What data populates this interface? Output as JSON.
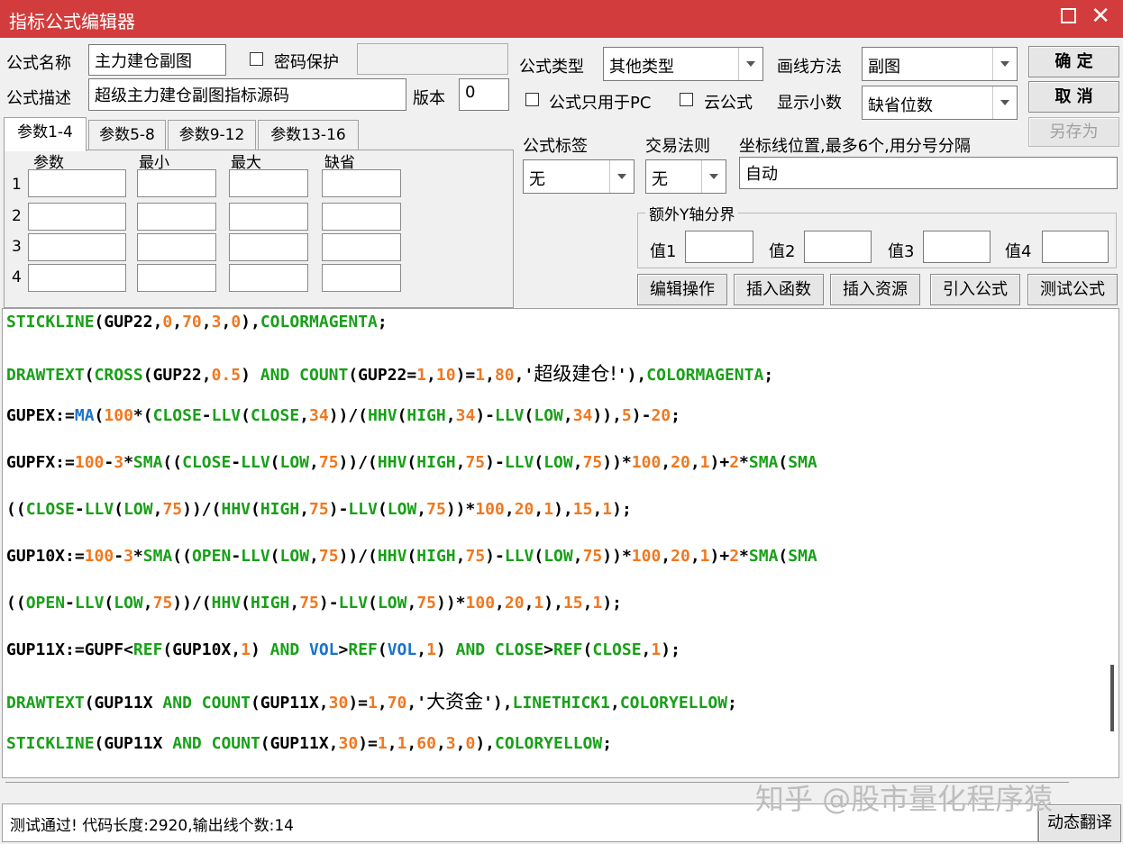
{
  "window": {
    "title": "指标公式编辑器"
  },
  "form": {
    "name_label": "公式名称",
    "name_value": "主力建仓副图",
    "password_label": "密码保护",
    "desc_label": "公式描述",
    "desc_value": "超级主力建仓副图指标源码",
    "version_label": "版本",
    "version_value": "0",
    "type_label": "公式类型",
    "type_value": "其他类型",
    "draw_label": "画线方法",
    "draw_value": "副图",
    "pc_only_label": "公式只用于PC",
    "cloud_label": "云公式",
    "decimals_label": "显示小数",
    "decimals_value": "缺省位数",
    "tag_label": "公式标签",
    "tag_value": "无",
    "trade_label": "交易法则",
    "trade_value": "无",
    "coord_label": "坐标线位置,最多6个,用分号分隔",
    "coord_value": "自动",
    "yaxis_legend": "额外Y轴分界",
    "y_values": [
      "值1",
      "值2",
      "值3",
      "值4"
    ]
  },
  "buttons": {
    "ok": "确 定",
    "cancel": "取 消",
    "save_as": "另存为",
    "edit_ops": "编辑操作",
    "insert_func": "插入函数",
    "insert_res": "插入资源",
    "import_formula": "引入公式",
    "test_formula": "测试公式",
    "dynamic_translate": "动态翻译"
  },
  "tabs": [
    "参数1-4",
    "参数5-8",
    "参数9-12",
    "参数13-16"
  ],
  "param_headers": [
    "参数",
    "最小",
    "最大",
    "缺省"
  ],
  "param_rows": [
    "1",
    "2",
    "3",
    "4"
  ],
  "code_lines": [
    [
      [
        "g",
        "STICKLINE"
      ],
      [
        "k",
        "(GUP22,"
      ],
      [
        "o",
        "0"
      ],
      [
        "k",
        ","
      ],
      [
        "o",
        "70"
      ],
      [
        "k",
        ","
      ],
      [
        "o",
        "3"
      ],
      [
        "k",
        ","
      ],
      [
        "o",
        "0"
      ],
      [
        "k",
        "),"
      ],
      [
        "g",
        "COLORMAGENTA"
      ],
      [
        "k",
        ";"
      ]
    ],
    [
      [
        "g",
        "DRAWTEXT"
      ],
      [
        "k",
        "("
      ],
      [
        "g",
        "CROSS"
      ],
      [
        "k",
        "(GUP22,"
      ],
      [
        "o",
        "0.5"
      ],
      [
        "k",
        ") "
      ],
      [
        "g",
        "AND"
      ],
      [
        "k",
        " "
      ],
      [
        "g",
        "COUNT"
      ],
      [
        "k",
        "(GUP22="
      ],
      [
        "o",
        "1"
      ],
      [
        "k",
        ","
      ],
      [
        "o",
        "10"
      ],
      [
        "k",
        ")="
      ],
      [
        "o",
        "1"
      ],
      [
        "k",
        ","
      ],
      [
        "o",
        "80"
      ],
      [
        "k",
        ",'"
      ],
      [
        "kz",
        "超级建仓!"
      ],
      [
        "k",
        "'),"
      ],
      [
        "g",
        "COLORMAGENTA"
      ],
      [
        "k",
        ";"
      ]
    ],
    [
      [
        "k",
        "GUPEX:="
      ],
      [
        "b",
        "MA"
      ],
      [
        "k",
        "("
      ],
      [
        "o",
        "100"
      ],
      [
        "k",
        "*("
      ],
      [
        "g",
        "CLOSE"
      ],
      [
        "k",
        "-"
      ],
      [
        "g",
        "LLV"
      ],
      [
        "k",
        "("
      ],
      [
        "g",
        "CLOSE"
      ],
      [
        "k",
        ","
      ],
      [
        "o",
        "34"
      ],
      [
        "k",
        "))/("
      ],
      [
        "g",
        "HHV"
      ],
      [
        "k",
        "("
      ],
      [
        "g",
        "HIGH"
      ],
      [
        "k",
        ","
      ],
      [
        "o",
        "34"
      ],
      [
        "k",
        ")-"
      ],
      [
        "g",
        "LLV"
      ],
      [
        "k",
        "("
      ],
      [
        "g",
        "LOW"
      ],
      [
        "k",
        ","
      ],
      [
        "o",
        "34"
      ],
      [
        "k",
        ")),"
      ],
      [
        "o",
        "5"
      ],
      [
        "k",
        ")-"
      ],
      [
        "o",
        "20"
      ],
      [
        "k",
        ";"
      ]
    ],
    [
      [
        "k",
        "GUPFX:="
      ],
      [
        "o",
        "100"
      ],
      [
        "k",
        "-"
      ],
      [
        "o",
        "3"
      ],
      [
        "k",
        "*"
      ],
      [
        "g",
        "SMA"
      ],
      [
        "k",
        "(("
      ],
      [
        "g",
        "CLOSE"
      ],
      [
        "k",
        "-"
      ],
      [
        "g",
        "LLV"
      ],
      [
        "k",
        "("
      ],
      [
        "g",
        "LOW"
      ],
      [
        "k",
        ","
      ],
      [
        "o",
        "75"
      ],
      [
        "k",
        "))/("
      ],
      [
        "g",
        "HHV"
      ],
      [
        "k",
        "("
      ],
      [
        "g",
        "HIGH"
      ],
      [
        "k",
        ","
      ],
      [
        "o",
        "75"
      ],
      [
        "k",
        ")-"
      ],
      [
        "g",
        "LLV"
      ],
      [
        "k",
        "("
      ],
      [
        "g",
        "LOW"
      ],
      [
        "k",
        ","
      ],
      [
        "o",
        "75"
      ],
      [
        "k",
        "))*"
      ],
      [
        "o",
        "100"
      ],
      [
        "k",
        ","
      ],
      [
        "o",
        "20"
      ],
      [
        "k",
        ","
      ],
      [
        "o",
        "1"
      ],
      [
        "k",
        ")+"
      ],
      [
        "o",
        "2"
      ],
      [
        "k",
        "*"
      ],
      [
        "g",
        "SMA"
      ],
      [
        "k",
        "("
      ],
      [
        "g",
        "SMA"
      ]
    ],
    [
      [
        "k",
        "(("
      ],
      [
        "g",
        "CLOSE"
      ],
      [
        "k",
        "-"
      ],
      [
        "g",
        "LLV"
      ],
      [
        "k",
        "("
      ],
      [
        "g",
        "LOW"
      ],
      [
        "k",
        ","
      ],
      [
        "o",
        "75"
      ],
      [
        "k",
        "))/("
      ],
      [
        "g",
        "HHV"
      ],
      [
        "k",
        "("
      ],
      [
        "g",
        "HIGH"
      ],
      [
        "k",
        ","
      ],
      [
        "o",
        "75"
      ],
      [
        "k",
        ")-"
      ],
      [
        "g",
        "LLV"
      ],
      [
        "k",
        "("
      ],
      [
        "g",
        "LOW"
      ],
      [
        "k",
        ","
      ],
      [
        "o",
        "75"
      ],
      [
        "k",
        "))*"
      ],
      [
        "o",
        "100"
      ],
      [
        "k",
        ","
      ],
      [
        "o",
        "20"
      ],
      [
        "k",
        ","
      ],
      [
        "o",
        "1"
      ],
      [
        "k",
        "),"
      ],
      [
        "o",
        "15"
      ],
      [
        "k",
        ","
      ],
      [
        "o",
        "1"
      ],
      [
        "k",
        ");"
      ]
    ],
    [
      [
        "k",
        "GUP10X:="
      ],
      [
        "o",
        "100"
      ],
      [
        "k",
        "-"
      ],
      [
        "o",
        "3"
      ],
      [
        "k",
        "*"
      ],
      [
        "g",
        "SMA"
      ],
      [
        "k",
        "(("
      ],
      [
        "g",
        "OPEN"
      ],
      [
        "k",
        "-"
      ],
      [
        "g",
        "LLV"
      ],
      [
        "k",
        "("
      ],
      [
        "g",
        "LOW"
      ],
      [
        "k",
        ","
      ],
      [
        "o",
        "75"
      ],
      [
        "k",
        "))/("
      ],
      [
        "g",
        "HHV"
      ],
      [
        "k",
        "("
      ],
      [
        "g",
        "HIGH"
      ],
      [
        "k",
        ","
      ],
      [
        "o",
        "75"
      ],
      [
        "k",
        ")-"
      ],
      [
        "g",
        "LLV"
      ],
      [
        "k",
        "("
      ],
      [
        "g",
        "LOW"
      ],
      [
        "k",
        ","
      ],
      [
        "o",
        "75"
      ],
      [
        "k",
        "))*"
      ],
      [
        "o",
        "100"
      ],
      [
        "k",
        ","
      ],
      [
        "o",
        "20"
      ],
      [
        "k",
        ","
      ],
      [
        "o",
        "1"
      ],
      [
        "k",
        ")+"
      ],
      [
        "o",
        "2"
      ],
      [
        "k",
        "*"
      ],
      [
        "g",
        "SMA"
      ],
      [
        "k",
        "("
      ],
      [
        "g",
        "SMA"
      ]
    ],
    [
      [
        "k",
        "(("
      ],
      [
        "g",
        "OPEN"
      ],
      [
        "k",
        "-"
      ],
      [
        "g",
        "LLV"
      ],
      [
        "k",
        "("
      ],
      [
        "g",
        "LOW"
      ],
      [
        "k",
        ","
      ],
      [
        "o",
        "75"
      ],
      [
        "k",
        "))/("
      ],
      [
        "g",
        "HHV"
      ],
      [
        "k",
        "("
      ],
      [
        "g",
        "HIGH"
      ],
      [
        "k",
        ","
      ],
      [
        "o",
        "75"
      ],
      [
        "k",
        ")-"
      ],
      [
        "g",
        "LLV"
      ],
      [
        "k",
        "("
      ],
      [
        "g",
        "LOW"
      ],
      [
        "k",
        ","
      ],
      [
        "o",
        "75"
      ],
      [
        "k",
        "))*"
      ],
      [
        "o",
        "100"
      ],
      [
        "k",
        ","
      ],
      [
        "o",
        "20"
      ],
      [
        "k",
        ","
      ],
      [
        "o",
        "1"
      ],
      [
        "k",
        "),"
      ],
      [
        "o",
        "15"
      ],
      [
        "k",
        ","
      ],
      [
        "o",
        "1"
      ],
      [
        "k",
        ");"
      ]
    ],
    [
      [
        "k",
        "GUP11X:=GUPF<"
      ],
      [
        "g",
        "REF"
      ],
      [
        "k",
        "(GUP10X,"
      ],
      [
        "o",
        "1"
      ],
      [
        "k",
        ") "
      ],
      [
        "g",
        "AND"
      ],
      [
        "k",
        " "
      ],
      [
        "b",
        "VOL"
      ],
      [
        "k",
        ">"
      ],
      [
        "g",
        "REF"
      ],
      [
        "k",
        "("
      ],
      [
        "b",
        "VOL"
      ],
      [
        "k",
        ","
      ],
      [
        "o",
        "1"
      ],
      [
        "k",
        ") "
      ],
      [
        "g",
        "AND"
      ],
      [
        "k",
        " "
      ],
      [
        "g",
        "CLOSE"
      ],
      [
        "k",
        ">"
      ],
      [
        "g",
        "REF"
      ],
      [
        "k",
        "("
      ],
      [
        "g",
        "CLOSE"
      ],
      [
        "k",
        ","
      ],
      [
        "o",
        "1"
      ],
      [
        "k",
        ");"
      ]
    ],
    [
      [
        "g",
        "DRAWTEXT"
      ],
      [
        "k",
        "(GUP11X "
      ],
      [
        "g",
        "AND"
      ],
      [
        "k",
        " "
      ],
      [
        "g",
        "COUNT"
      ],
      [
        "k",
        "(GUP11X,"
      ],
      [
        "o",
        "30"
      ],
      [
        "k",
        ")="
      ],
      [
        "o",
        "1"
      ],
      [
        "k",
        ","
      ],
      [
        "o",
        "70"
      ],
      [
        "k",
        ",'"
      ],
      [
        "kz",
        "大资金"
      ],
      [
        "k",
        "'),"
      ],
      [
        "g",
        "LINETHICK1"
      ],
      [
        "k",
        ","
      ],
      [
        "g",
        "COLORYELLOW"
      ],
      [
        "k",
        ";"
      ]
    ],
    [
      [
        "g",
        "STICKLINE"
      ],
      [
        "k",
        "(GUP11X "
      ],
      [
        "g",
        "AND"
      ],
      [
        "k",
        " "
      ],
      [
        "g",
        "COUNT"
      ],
      [
        "k",
        "(GUP11X,"
      ],
      [
        "o",
        "30"
      ],
      [
        "k",
        ")="
      ],
      [
        "o",
        "1"
      ],
      [
        "k",
        ","
      ],
      [
        "o",
        "1"
      ],
      [
        "k",
        ","
      ],
      [
        "o",
        "60"
      ],
      [
        "k",
        ","
      ],
      [
        "o",
        "3"
      ],
      [
        "k",
        ","
      ],
      [
        "o",
        "0"
      ],
      [
        "k",
        "),"
      ],
      [
        "g",
        "COLORYELLOW"
      ],
      [
        "k",
        ";"
      ]
    ]
  ],
  "status": {
    "text": "测试通过! 代码长度:2920,输出线个数:14"
  },
  "watermark": "知乎 @股市量化程序猿",
  "colors": {
    "title_bar": "#d23c3c",
    "keyword": "#18a018",
    "number": "#f07820",
    "builtin": "#1a73c8"
  }
}
